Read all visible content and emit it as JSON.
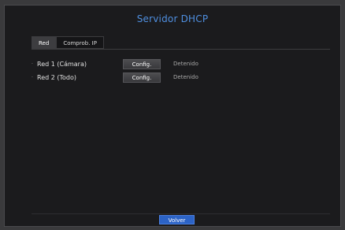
{
  "dialog": {
    "title": "Servidor DHCP"
  },
  "tabs": [
    {
      "label": "Red",
      "active": true
    },
    {
      "label": "Comprob. IP",
      "active": false
    }
  ],
  "rows": [
    {
      "label": "Red 1 (Cámara)",
      "button": "Config.",
      "status": "Detenido"
    },
    {
      "label": "Red 2 (Todo)",
      "button": "Config.",
      "status": "Detenido"
    }
  ],
  "footer": {
    "back_label": "Volver"
  },
  "colors": {
    "title": "#4f8fe0",
    "primary_button": "#2c63c6",
    "background": "#1b1b1d"
  },
  "icons": {
    "row_bullet": "bullet-dot-icon"
  }
}
